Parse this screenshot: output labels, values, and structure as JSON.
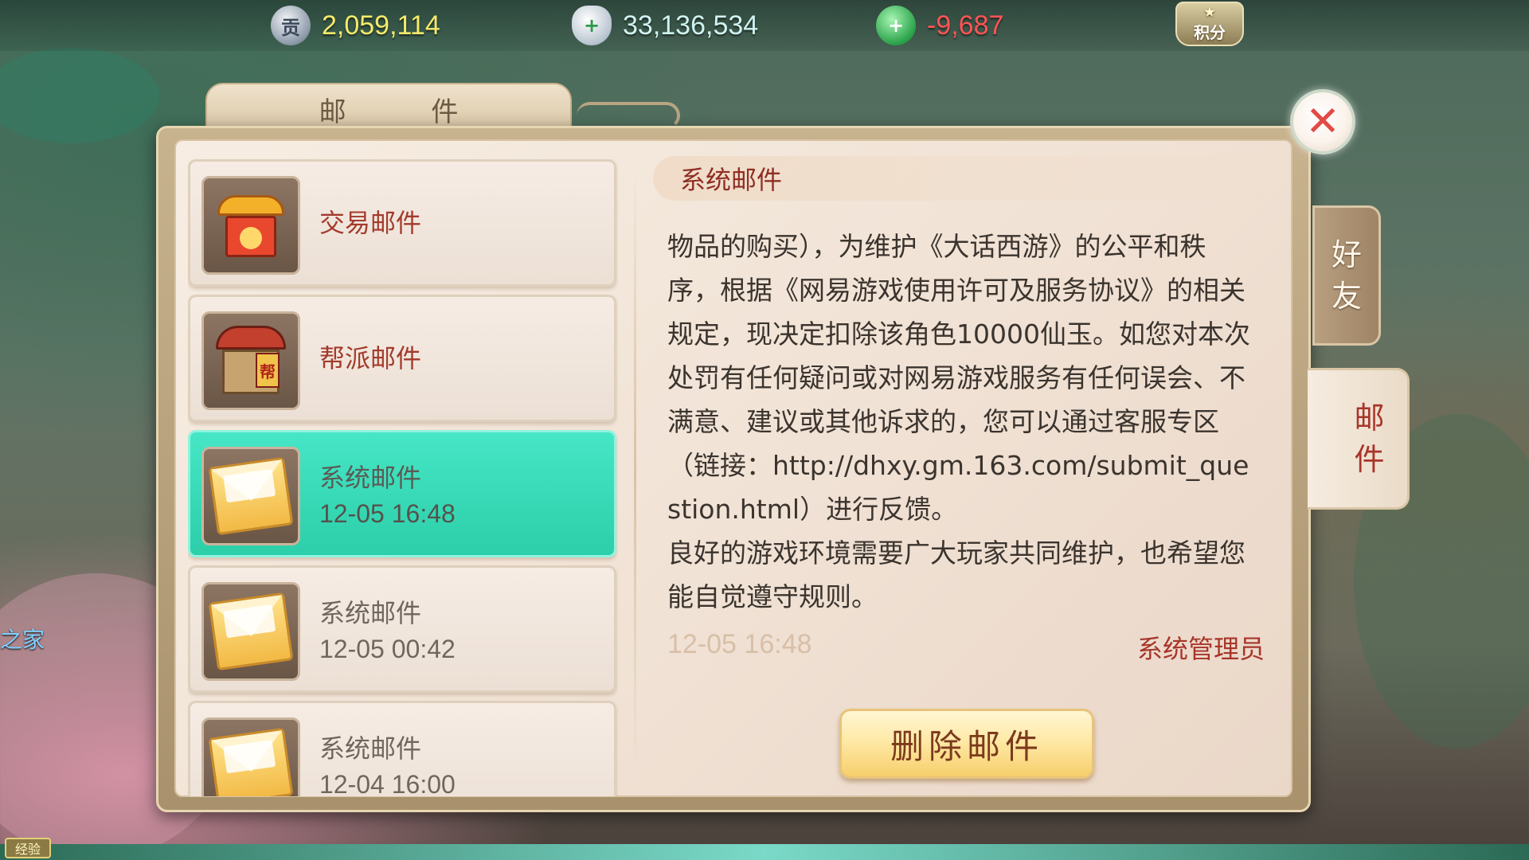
{
  "currencies": [
    {
      "icon": "contribution-coin-icon",
      "glyph": "贡",
      "value": "2,059,114"
    },
    {
      "icon": "silver-ingot-icon",
      "glyph": "+",
      "value": "33,136,534"
    },
    {
      "icon": "jade-icon",
      "glyph": "+",
      "value": "-9,687"
    }
  ],
  "points_badge": {
    "icon": "points-star-icon",
    "label": "积分"
  },
  "panel": {
    "title": "邮 件"
  },
  "close_glyph": "✕",
  "side_tabs": [
    {
      "label": "好\n友",
      "active": false
    },
    {
      "label": "邮\n件",
      "active": true
    }
  ],
  "mail_list": [
    {
      "icon": "trade-shop-icon",
      "title": "交易邮件",
      "time": ""
    },
    {
      "icon": "guild-house-icon",
      "title": "帮派邮件",
      "time": ""
    },
    {
      "icon": "envelope-icon",
      "title": "系统邮件",
      "time": "12-05 16:48",
      "active": true
    },
    {
      "icon": "envelope-icon",
      "title": "系统邮件",
      "time": "12-05 00:42"
    },
    {
      "icon": "envelope-icon",
      "title": "系统邮件",
      "time": "12-04 16:00"
    }
  ],
  "guild_flag_glyph": "帮",
  "detail": {
    "header": "系统邮件",
    "body": "物品的购买），为维护《大话西游》的公平和秩序，根据《网易游戏使用许可及服务协议》的相关规定，现决定扣除该角色10000仙玉。如您对本次处罚有任何疑问或对网易游戏服务有任何误会、不满意、建议或其他诉求的，您可以通过客服专区（链接：http://dhxy.gm.163.com/submit_question.html）进行反馈。\n良好的游戏环境需要广大玩家共同维护，也希望您能自觉遵守规则。",
    "time": "12-05 16:48",
    "sender": "系统管理员",
    "delete_label": "删除邮件"
  },
  "bottom": {
    "exp_label": "经验",
    "side_text": "之家"
  },
  "colors": {
    "active_item": "#2ccfa9",
    "title_red": "#a33b2d",
    "close_red": "#e24a45",
    "gold_value": "#f4ea6a",
    "negative_value": "#ff5454"
  }
}
